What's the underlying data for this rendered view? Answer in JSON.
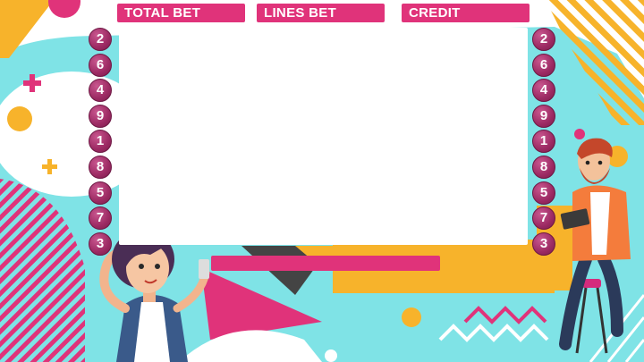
{
  "header": {
    "total_bet_label": "TOTAL BET",
    "lines_bet_label": "LINES BET",
    "credit_label": "CREDIT"
  },
  "paylines": {
    "left": [
      "2",
      "6",
      "4",
      "9",
      "1",
      "8",
      "5",
      "7",
      "3"
    ],
    "right": [
      "2",
      "6",
      "4",
      "9",
      "1",
      "8",
      "5",
      "7",
      "3"
    ]
  },
  "colors": {
    "accent_pink": "#e0337a",
    "badge_purple": "#9c2a63",
    "background_cyan": "#7fe3e6",
    "accent_yellow": "#f7b32b",
    "reel_panel": "#ffffff"
  },
  "decor": {
    "characters": [
      "woman-character",
      "bearded-man-with-tablet-character"
    ],
    "icons": [
      "plus-icon",
      "plus-icon"
    ]
  }
}
